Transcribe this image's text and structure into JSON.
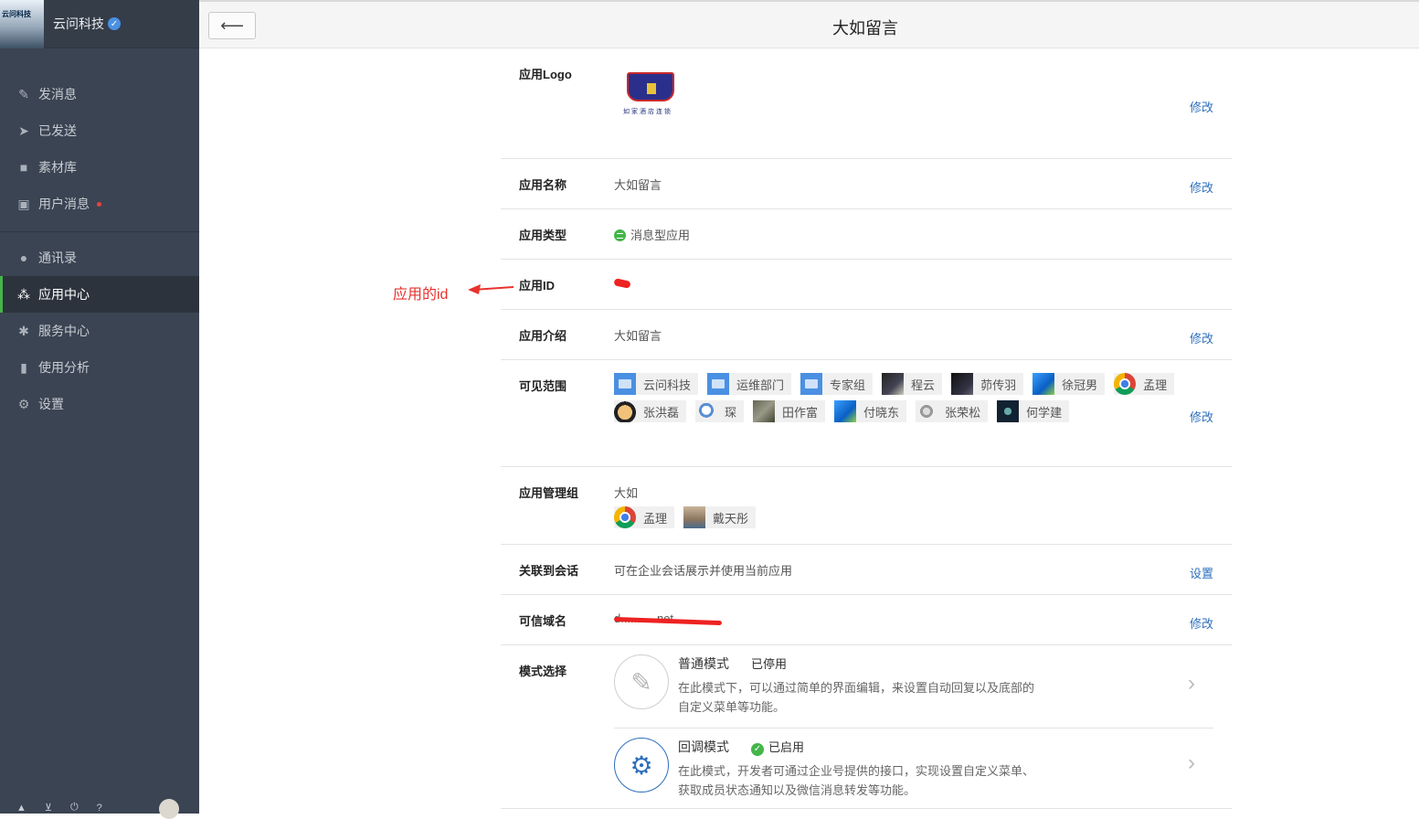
{
  "brand": {
    "name": "云问科技",
    "logo_text": "云问科技"
  },
  "nav_primary": [
    {
      "icon": "pencil-icon",
      "glyph": "✎",
      "label": "发消息"
    },
    {
      "icon": "send-icon",
      "glyph": "➤",
      "label": "已发送"
    },
    {
      "icon": "folder-icon",
      "glyph": "■",
      "label": "素材库"
    },
    {
      "icon": "chat-icon",
      "glyph": "▣",
      "label": "用户消息"
    }
  ],
  "nav_secondary": [
    {
      "icon": "user-icon",
      "glyph": "●",
      "label": "通讯录"
    },
    {
      "icon": "apps-icon",
      "glyph": "⁂",
      "label": "应用中心",
      "active": true
    },
    {
      "icon": "service-icon",
      "glyph": "✱",
      "label": "服务中心"
    },
    {
      "icon": "bar-chart-icon",
      "glyph": "▮",
      "label": "使用分析"
    },
    {
      "icon": "gear-icon",
      "glyph": "⚙",
      "label": "设置"
    }
  ],
  "topbar": {
    "back_glyph": "⟵",
    "title": "大如留言"
  },
  "annotation": {
    "text": "应用的id",
    "color": "#e8332e"
  },
  "rows": {
    "logo": {
      "label": "应用Logo",
      "action": "修改",
      "logo_caption": "如家酒店连锁"
    },
    "name": {
      "label": "应用名称",
      "value": "大如留言",
      "action": "修改"
    },
    "type": {
      "label": "应用类型",
      "value": "消息型应用"
    },
    "id": {
      "label": "应用ID"
    },
    "intro": {
      "label": "应用介绍",
      "value": "大如留言",
      "action": "修改"
    },
    "scope": {
      "label": "可见范围",
      "action": "修改",
      "members": [
        {
          "name": "云问科技",
          "avatar": "folder"
        },
        {
          "name": "运维部门",
          "avatar": "folder"
        },
        {
          "name": "专家组",
          "avatar": "folder"
        },
        {
          "name": "程云",
          "avatar": "photo1"
        },
        {
          "name": "茆传羽",
          "avatar": "photo2"
        },
        {
          "name": "徐冠男",
          "avatar": "win"
        },
        {
          "name": "孟理",
          "avatar": "chrome"
        },
        {
          "name": "张洪磊",
          "avatar": "cartoon"
        },
        {
          "name": "琛",
          "avatar": "robot"
        },
        {
          "name": "田作富",
          "avatar": "rock"
        },
        {
          "name": "付晓东",
          "avatar": "win"
        },
        {
          "name": "张荣松",
          "avatar": "face"
        },
        {
          "name": "何学建",
          "avatar": "dark"
        }
      ]
    },
    "admin": {
      "label": "应用管理组",
      "group": "大如",
      "members": [
        {
          "name": "孟理",
          "avatar": "chrome"
        },
        {
          "name": "戴天彤",
          "avatar": "man"
        }
      ]
    },
    "session": {
      "label": "关联到会话",
      "value": "可在企业会话展示并使用当前应用",
      "action": "设置"
    },
    "domain": {
      "label": "可信域名",
      "value": "d...........net",
      "action": "修改"
    },
    "mode": {
      "label": "模式选择",
      "modes": [
        {
          "name": "普通模式",
          "status": "已停用",
          "desc": "在此模式下，可以通过简单的界面编辑，来设置自动回复以及底部的自定义菜单等功能。"
        },
        {
          "name": "回调模式",
          "status": "已启用",
          "desc": "在此模式，开发者可通过企业号提供的接口，实现设置自定义菜单、获取成员状态通知以及微信消息转发等功能。"
        }
      ]
    }
  },
  "footer_icons": [
    "home-icon",
    "cart-icon",
    "power-icon",
    "help-icon"
  ]
}
